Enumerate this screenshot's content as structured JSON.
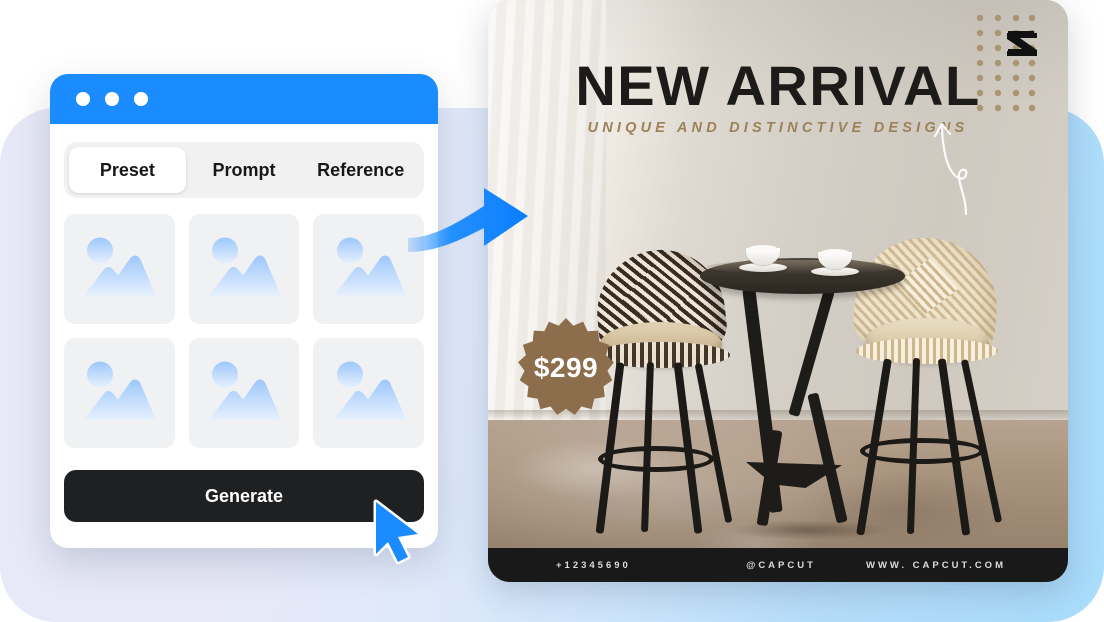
{
  "app_window": {
    "titlebar": {
      "dots": 3,
      "color": "#1a8cff"
    },
    "tabs": [
      {
        "label": "Preset",
        "active": true
      },
      {
        "label": "Prompt",
        "active": false
      },
      {
        "label": "Reference",
        "active": false
      }
    ],
    "thumbnails": [
      {
        "icon": "image-placeholder-icon"
      },
      {
        "icon": "image-placeholder-icon"
      },
      {
        "icon": "image-placeholder-icon"
      },
      {
        "icon": "image-placeholder-icon"
      },
      {
        "icon": "image-placeholder-icon"
      },
      {
        "icon": "image-placeholder-icon"
      }
    ],
    "generate_button": {
      "label": "Generate",
      "color": "#1f2022"
    },
    "cursor": {
      "icon": "mouse-pointer-icon",
      "color": "#1a8cff"
    }
  },
  "flow_arrow": {
    "icon": "curved-right-arrow-icon",
    "color": "#1a8cff"
  },
  "poster": {
    "logo": {
      "icon": "capcut-logo-icon"
    },
    "title": "NEW ARRIVAL",
    "subtitle": "UNIQUE AND DISTINCTIVE DESIGNS",
    "subtitle_color": "#9b8258",
    "decor": {
      "dot_grid": {
        "icon": "dot-grid-icon",
        "columns": 4,
        "rows": 8,
        "color": "#a89572"
      },
      "hand_arrow": {
        "icon": "hand-drawn-curved-arrow-icon",
        "color": "#ffffff"
      }
    },
    "price_badge": {
      "value": "$299",
      "shape": "starburst",
      "color": "#8c6d4c",
      "text_color": "#ffffff"
    },
    "scene": {
      "description": "two rattan bar stools with a dark round bistro table and two coffee cups"
    },
    "footer": {
      "phone": "+12345690",
      "handle": "@CAPCUT",
      "website": "WWW. CAPCUT.COM",
      "background": "#19191a"
    }
  },
  "backdrop": {
    "gradient_from": "#e7e9f8",
    "gradient_to": "#a9dcfb"
  }
}
